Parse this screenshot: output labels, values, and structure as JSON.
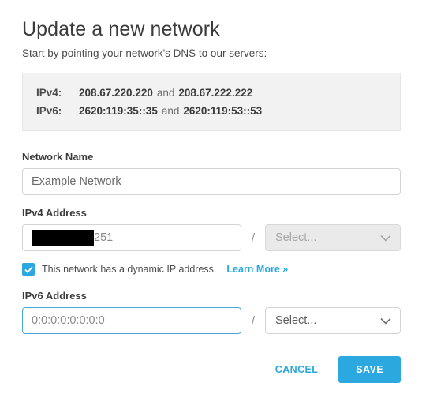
{
  "header": {
    "title": "Update a new network",
    "subtitle": "Start by pointing your network's DNS to our servers:"
  },
  "dns_info": {
    "rows": [
      {
        "label": "IPv4:",
        "primary": "208.67.220.220",
        "conjunction": "and",
        "secondary": "208.67.222.222"
      },
      {
        "label": "IPv6:",
        "primary": "2620:119:35::35",
        "conjunction": "and",
        "secondary": "2620:119:53::53"
      }
    ]
  },
  "form": {
    "network_name": {
      "label": "Network Name",
      "value": "Example Network"
    },
    "ipv4": {
      "label": "IPv4 Address",
      "value_visible": "251",
      "separator": "/",
      "prefix_select": {
        "value": "Select...",
        "chevron": "chevron-down-icon",
        "disabled": true
      }
    },
    "dynamic_ip": {
      "checked": true,
      "label": "This network has a dynamic IP address.",
      "learn_more": "Learn More »"
    },
    "ipv6": {
      "label": "IPv6 Address",
      "placeholder": "0:0:0:0:0:0:0:0",
      "separator": "/",
      "focused": true,
      "prefix_select": {
        "value": "Select...",
        "chevron": "chevron-down-icon",
        "disabled": false
      }
    }
  },
  "actions": {
    "cancel_label": "CANCEL",
    "save_label": "SAVE"
  },
  "colors": {
    "accent": "#2ba8e0",
    "info_box_bg": "#f2f2f2",
    "redaction": "#000000",
    "focus_border": "#4aa8d8"
  }
}
